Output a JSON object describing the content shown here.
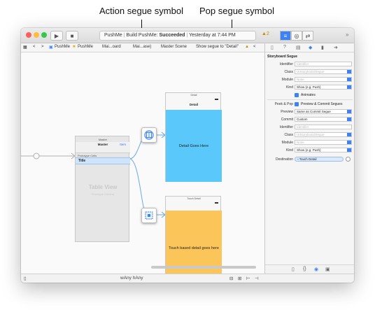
{
  "callouts": {
    "action": "Action segue symbol",
    "pop": "Pop segue symbol"
  },
  "titlebar": {
    "run_icon": "play-icon",
    "stop_icon": "stop-icon",
    "scheme": "PushMe",
    "status_prefix": "Build PushMe: ",
    "status_result": "Succeeded",
    "status_time": "Yesterday at 7:44 PM",
    "warning_count": "2",
    "warning_icon": "warning-triangle-icon",
    "chevron": "»"
  },
  "jumpbar": {
    "grid_icon": "grid-icon",
    "back": "<",
    "forward": ">",
    "crumbs": [
      "PushMe",
      "PushMe",
      "Mai...oard",
      "Mai...ase)",
      "Master Scene",
      "Show segue to \"Detail\""
    ],
    "warn": "<"
  },
  "inspector_tabs": [
    "file-icon",
    "help-icon",
    "identity-icon",
    "attributes-icon",
    "size-icon",
    "connections-icon"
  ],
  "canvas": {
    "master": {
      "label": "Master",
      "nav_title": "Master",
      "nav_item": "Item",
      "proto": "Prototype Cells",
      "cell": "Title",
      "table_view": "Table View",
      "table_sub": "Prototype Content"
    },
    "detail": {
      "label": "Detail",
      "nav_title": "Detail",
      "body": "Detail Goes Here",
      "color": "#5ac8fa"
    },
    "touch": {
      "label": "Touch Detail",
      "body": "Touch based detail goes here",
      "color": "#fcc55a"
    },
    "action_segue_icon": "action-segue-icon",
    "pop_segue_icon": "pop-segue-icon"
  },
  "bottom": {
    "sidebar_icon": "sidebar-toggle-icon",
    "size_class": "wAny hAny",
    "tools": [
      "align-icon",
      "pin-icon",
      "resolve-icon",
      "resize-icon"
    ]
  },
  "inspector": {
    "section": "Storyboard Segue",
    "identifier_label": "Identifier",
    "identifier_ph": "Identifier",
    "class_label": "Class",
    "class_ph": "UIStoryboardSegue",
    "module_label": "Module",
    "module_ph": "None",
    "kind_label": "Kind",
    "kind_value": "Show (e.g. Push)",
    "animates": "Animates",
    "peek_label": "Peek & Pop",
    "peek_value": "Preview & Commit Segues",
    "preview_label": "Preview",
    "preview_value": "Same as Commit Segue",
    "commit_label": "Commit",
    "commit_value": "Custom",
    "identifier2_label": "Identifier",
    "identifier2_ph": "Identifier",
    "class2_label": "Class",
    "class2_ph": "UIStoryboardSegue",
    "module2_label": "Module",
    "module2_ph": "None",
    "kind2_label": "Kind",
    "kind2_value": "Show (e.g. Push)",
    "destination_label": "Destination",
    "destination_value": "Touch Detail",
    "bottom_icons": [
      "file-template-icon",
      "code-snippet-icon",
      "object-library-icon",
      "media-library-icon"
    ],
    "accent": "#3b82f6"
  }
}
